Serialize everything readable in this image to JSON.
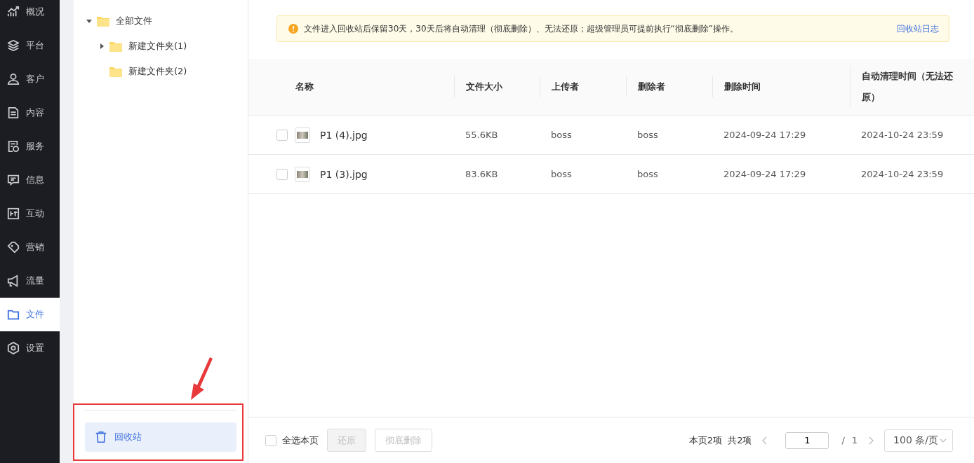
{
  "nav": {
    "items": [
      {
        "label": "概况",
        "selected": false
      },
      {
        "label": "平台",
        "selected": false
      },
      {
        "label": "客户",
        "selected": false
      },
      {
        "label": "内容",
        "selected": false
      },
      {
        "label": "服务",
        "selected": false
      },
      {
        "label": "信息",
        "selected": false
      },
      {
        "label": "互动",
        "selected": false
      },
      {
        "label": "营销",
        "selected": false
      },
      {
        "label": "流量",
        "selected": false
      },
      {
        "label": "文件",
        "selected": true
      },
      {
        "label": "设置",
        "selected": false
      }
    ]
  },
  "folder_tree": {
    "items": [
      {
        "label": "全部文件",
        "expanded": true,
        "children": [
          {
            "label": "新建文件夹(1)",
            "expanded": false
          },
          {
            "label": "新建文件夹(2)"
          }
        ]
      }
    ]
  },
  "recycle_bin": {
    "label": "回收站",
    "selected": true
  },
  "notice": {
    "text": "文件进入回收站后保留30天，30天后将自动清理（彻底删除）、无法还原；超级管理员可提前执行“彻底删除”操作。",
    "link": "回收站日志"
  },
  "table": {
    "columns": [
      "名称",
      "文件大小",
      "上传者",
      "删除者",
      "删除时间",
      "自动清理时间（无法还原）"
    ],
    "rows": [
      {
        "selected": false,
        "cells": [
          "P1 (4).jpg",
          "55.6KB",
          "boss",
          "boss",
          "2024-09-24 17:29",
          "2024-10-24 23:59"
        ]
      },
      {
        "selected": false,
        "cells": [
          "P1 (3).jpg",
          "83.6KB",
          "boss",
          "boss",
          "2024-09-24 17:29",
          "2024-10-24 23:59"
        ]
      }
    ]
  },
  "footer": {
    "select_all": {
      "label": "全选本页",
      "checked": false
    },
    "buttons": [
      {
        "label": "还原",
        "kind": "filled",
        "disabled": true
      },
      {
        "label": "彻底删除",
        "kind": "outline",
        "disabled": true
      }
    ],
    "summary": "本页2项  共2项",
    "page": "1",
    "separator": "/",
    "total_pages": "1",
    "page_size": "100 条/页"
  }
}
